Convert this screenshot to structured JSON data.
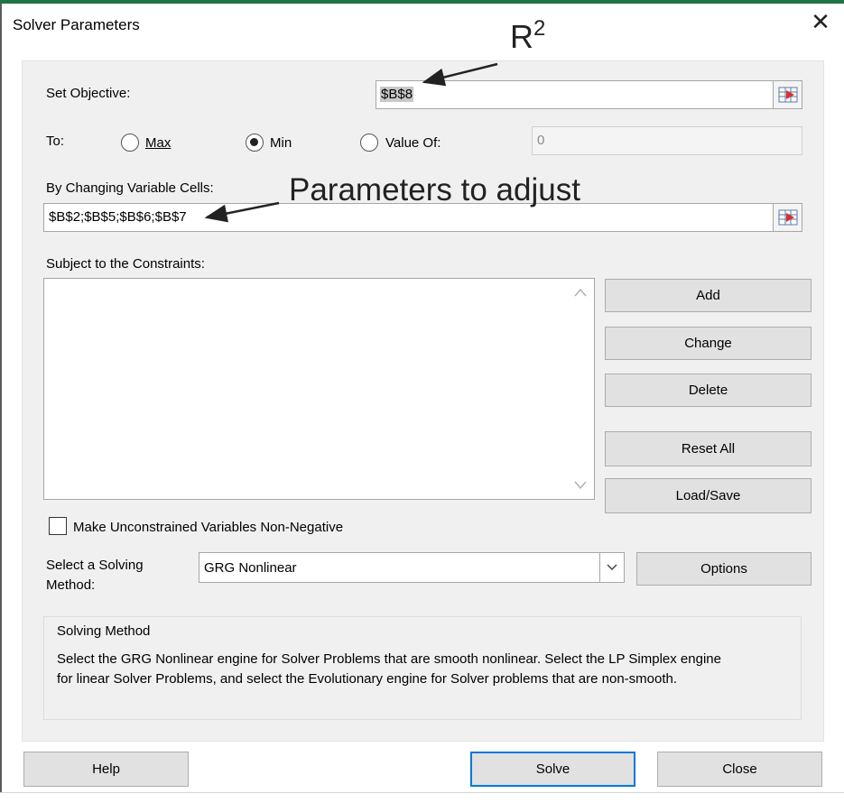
{
  "dialog": {
    "title": "Solver Parameters",
    "close_glyph": "✕"
  },
  "objective": {
    "label": "Set Objective:",
    "value": "$B$8"
  },
  "to": {
    "label": "To:",
    "options": [
      {
        "label": "Max",
        "selected": false
      },
      {
        "label": "Min",
        "selected": true
      },
      {
        "label": "Value Of:",
        "selected": false
      }
    ],
    "value_of": "0"
  },
  "variable_cells": {
    "label": "By Changing Variable Cells:",
    "value": "$B$2;$B$5;$B$6;$B$7"
  },
  "constraints": {
    "label": "Subject to the Constraints:",
    "items": []
  },
  "side_buttons": {
    "add": "Add",
    "change": "Change",
    "delete": "Delete",
    "reset_all": "Reset All",
    "load_save": "Load/Save"
  },
  "nonneg_checkbox": {
    "label": "Make Unconstrained Variables Non-Negative",
    "checked": false
  },
  "solving_method": {
    "label_line1": "Select a Solving",
    "label_line2": "Method:",
    "selected": "GRG Nonlinear",
    "options_button": "Options"
  },
  "method_info": {
    "heading": "Solving Method",
    "line1": "Select the GRG Nonlinear engine for Solver Problems that are smooth nonlinear. Select the LP Simplex engine",
    "line2": "for linear Solver Problems, and select the Evolutionary engine for Solver problems that are non-smooth."
  },
  "footer": {
    "help": "Help",
    "solve": "Solve",
    "close": "Close"
  },
  "annotations": {
    "r2_base": "R",
    "r2_sup": "2",
    "params": "Parameters to adjust"
  },
  "colors": {
    "accent": "#0078d7",
    "excel_green": "#217346"
  }
}
